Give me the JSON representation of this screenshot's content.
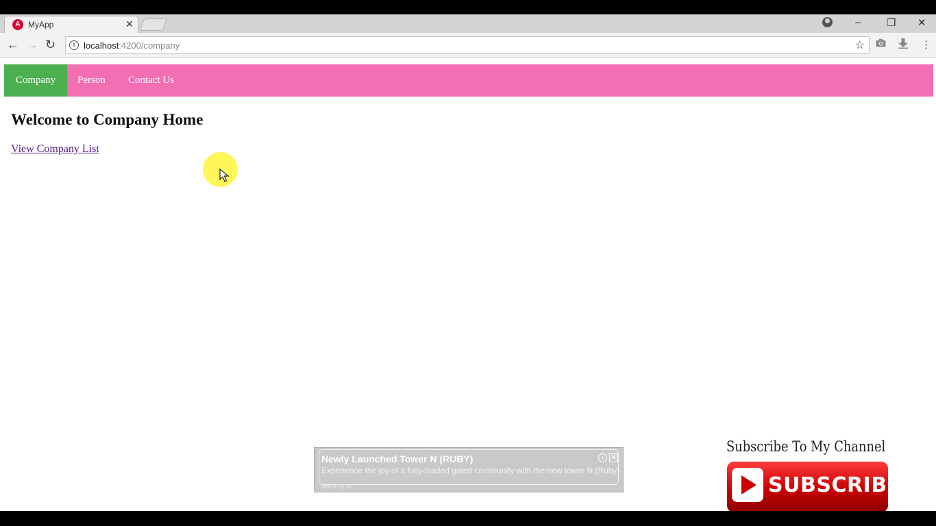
{
  "browser": {
    "tab_title": "MyApp",
    "favicon_letter": "A",
    "url_host": "localhost",
    "url_rest": ":4200/company"
  },
  "icons": {
    "back": "arrow-left-icon",
    "forward": "arrow-right-icon",
    "reload": "reload-icon",
    "info": "info-icon",
    "star": "star-icon",
    "camera": "camera-icon",
    "download": "download-icon",
    "menu": "kebab-menu-icon"
  },
  "navbar": {
    "items": [
      {
        "label": "Company",
        "active": true
      },
      {
        "label": "Person",
        "active": false
      },
      {
        "label": "Contact Us",
        "active": false
      }
    ]
  },
  "main": {
    "heading": "Welcome to Company Home",
    "link": "View Company List"
  },
  "ad": {
    "title": "Newly Launched Tower N (RUBY)",
    "description": "Experience the joy of a fully-loaded gated community with the new tower N (Ruby)",
    "source": "pbelcity.in"
  },
  "overlay": {
    "subscribe_title": "Subscribe To My Channel",
    "subscribe_label": "SUBSCRIBE"
  },
  "colors": {
    "navbar": "#f46eb4",
    "nav_active": "#4caf50",
    "link": "#551a8b"
  }
}
